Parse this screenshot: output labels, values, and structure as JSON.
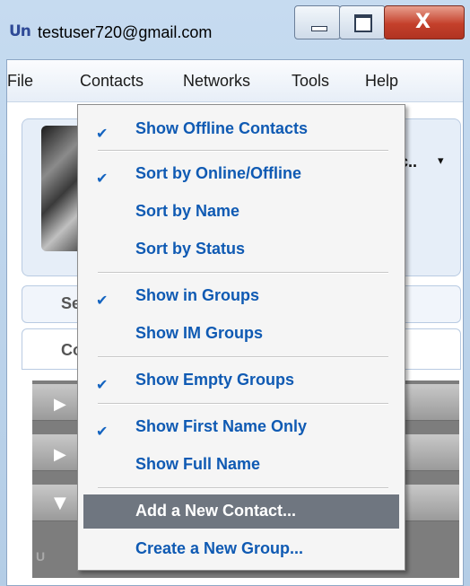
{
  "window": {
    "icon_text": "Un",
    "title": "testuser720@gmail.com",
    "minimize_glyph": "",
    "maximize_glyph": "",
    "close_glyph": "X"
  },
  "menubar": {
    "items": [
      "File",
      "Contacts",
      "Networks",
      "Tools",
      "Help"
    ]
  },
  "profile": {
    "name_tail": ".c..",
    "name_arrow": "▾"
  },
  "tabs": {
    "search_partial": "Se",
    "contacts_partial": "Co"
  },
  "groups": {
    "row_arrows": [
      "▶",
      "▶",
      "▼"
    ],
    "dim_item": "U"
  },
  "contacts_menu": {
    "checkmark": "✔",
    "items": [
      {
        "label": "Show Offline Contacts",
        "checked": true
      },
      {
        "label": "Sort by Online/Offline",
        "checked": true
      },
      {
        "label": "Sort by Name",
        "checked": false
      },
      {
        "label": "Sort by Status",
        "checked": false
      },
      {
        "label": "Show in Groups",
        "checked": true
      },
      {
        "label": "Show IM Groups",
        "checked": false
      },
      {
        "label": "Show Empty Groups",
        "checked": true
      },
      {
        "label": "Show First Name Only",
        "checked": true
      },
      {
        "label": "Show Full Name",
        "checked": false
      },
      {
        "label": "Add a New Contact...",
        "checked": false,
        "highlighted": true
      },
      {
        "label": "Create a New Group...",
        "checked": false
      }
    ]
  },
  "colors": {
    "menu_text": "#0f5ab3",
    "checkmark": "#1464c0",
    "highlight_bg": "#6f7680"
  }
}
